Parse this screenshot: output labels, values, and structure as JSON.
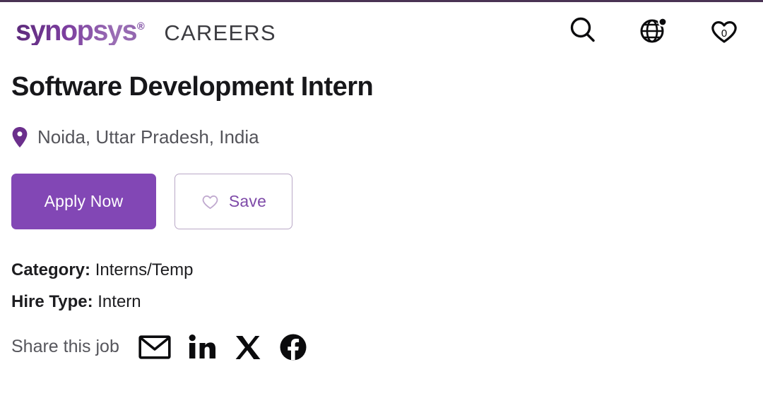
{
  "top_rule_color": "#4a3354",
  "brand": {
    "logo_text": "synopsys",
    "logo_trademark": "®",
    "logo_color": "#6b2f8c",
    "careers_text": "CAREERS",
    "careers_color": "#3c3c41"
  },
  "header": {
    "actions": [
      {
        "name": "search-icon",
        "label": "Search"
      },
      {
        "name": "globe-icon",
        "label": "Language",
        "has_dot_badge": true
      },
      {
        "name": "heart-icon",
        "label": "Saved jobs",
        "count": "0"
      }
    ],
    "saved_count": "0"
  },
  "job": {
    "title": "Software Development Intern",
    "location": "Noida, Uttar Pradesh, India",
    "location_icon": "map-pin-icon"
  },
  "actions": {
    "apply_label": "Apply Now",
    "apply_bg": "#8247b5",
    "save_label": "Save",
    "save_icon": "heart-outline-icon",
    "save_border": "#b9a8c7",
    "save_text_color": "#7e4aa8"
  },
  "details": [
    {
      "label": "Category:",
      "value": "Interns/Temp"
    },
    {
      "label": "Hire Type:",
      "value": "Intern"
    }
  ],
  "share": {
    "label": "Share this job",
    "items": [
      {
        "name": "email-icon",
        "label": "Email"
      },
      {
        "name": "linkedin-icon",
        "label": "LinkedIn"
      },
      {
        "name": "x-twitter-icon",
        "label": "X"
      },
      {
        "name": "facebook-icon",
        "label": "Facebook"
      }
    ]
  }
}
